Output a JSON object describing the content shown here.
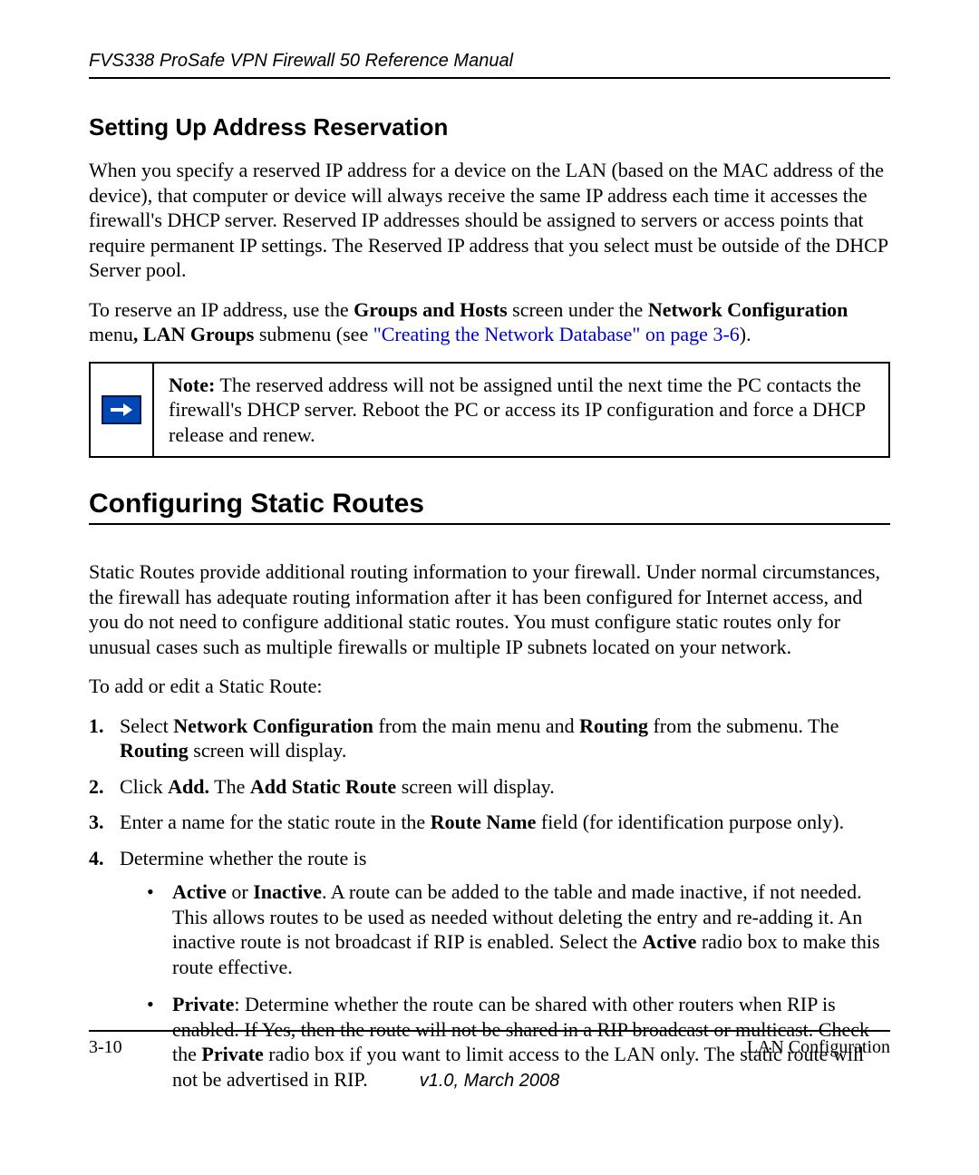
{
  "header": {
    "running": "FVS338 ProSafe VPN Firewall 50 Reference Manual"
  },
  "section1": {
    "title": "Setting Up Address Reservation",
    "p1": "When you specify a reserved IP address for a device on the LAN (based on the MAC address of the device), that computer or device will always receive the same IP address each time it accesses the firewall's DHCP server. Reserved IP addresses should be assigned to servers or access points that require permanent IP settings. The Reserved IP address that you select must be outside of the DHCP Server pool.",
    "p2_pre": "To reserve an IP address, use the ",
    "p2_b1": "Groups and Hosts",
    "p2_mid1": " screen under the ",
    "p2_b2": "Network Configuration",
    "p2_mid2": " menu",
    "p2_b3": ", LAN Groups",
    "p2_mid3": " submenu (see ",
    "p2_link": "\"Creating the Network Database\" on page 3-6",
    "p2_post": ")."
  },
  "note": {
    "label": "Note:",
    "text": " The reserved address will not be assigned until the next time the PC contacts the firewall's DHCP server. Reboot the PC or access its IP configuration and force a DHCP release and renew."
  },
  "section2": {
    "title": "Configuring Static Routes",
    "intro": "Static Routes provide additional routing information to your firewall. Under normal circumstances, the firewall has adequate routing information after it has been configured for Internet access, and you do not need to configure additional static routes. You must configure static routes only for unusual cases such as multiple firewalls or multiple IP subnets located on your network.",
    "lead": "To add or edit a Static Route:",
    "steps": {
      "s1_pre": "Select ",
      "s1_b1": "Network Configuration",
      "s1_mid1": " from the main menu and ",
      "s1_b2": "Routing",
      "s1_mid2": " from the submenu. The ",
      "s1_b3": "Routing",
      "s1_post": " screen will display.",
      "s2_pre": "Click ",
      "s2_b1": "Add.",
      "s2_mid1": " The ",
      "s2_b2": "Add Static Route",
      "s2_post": " screen will display.",
      "s3_pre": "Enter a name for the static route in the ",
      "s3_b1": "Route Name",
      "s3_post": " field (for identification purpose only).",
      "s4": "Determine whether the route is"
    },
    "bullets": {
      "b1_b1": "Active",
      "b1_mid1": " or ",
      "b1_b2": "Inactive",
      "b1_mid2": ". A route can be added to the table and made inactive, if not needed. This allows routes to be used as needed without deleting the entry and re-adding it. An inactive route is not broadcast if RIP is enabled. Select the ",
      "b1_b3": "Active",
      "b1_post": " radio box to make this route effective.",
      "b2_b1": "Private",
      "b2_mid1": ": Determine whether the route can be shared with other routers when RIP is enabled. If Yes, then the route will not be shared in a RIP broadcast or multicast. Check the ",
      "b2_b2": "Private",
      "b2_post": " radio box if you want to limit access to the LAN only. The static route will not be advertised in RIP."
    }
  },
  "footer": {
    "left": "3-10",
    "right": "LAN Configuration",
    "version": "v1.0, March 2008"
  }
}
